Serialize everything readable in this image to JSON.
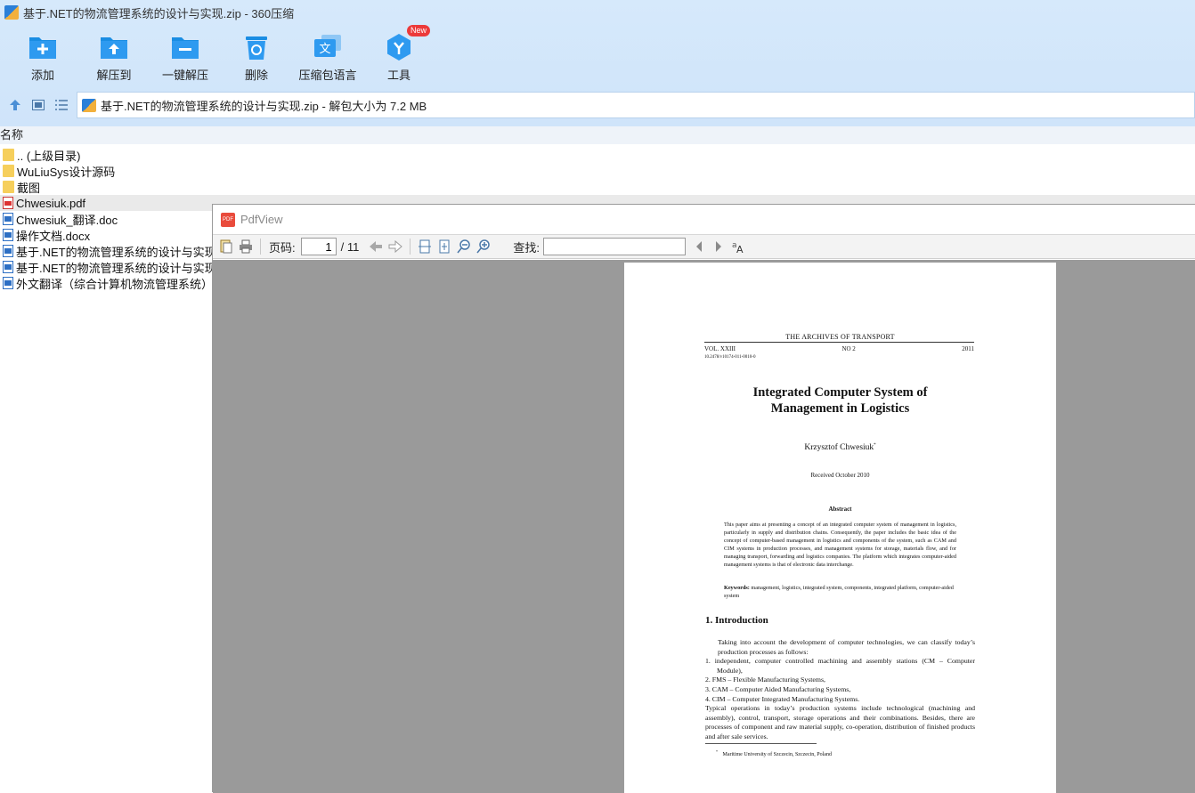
{
  "window": {
    "title": "基于.NET的物流管理系统的设计与实现.zip - 360压缩"
  },
  "toolbar": {
    "items": [
      {
        "label": "添加",
        "icon": "add-icon"
      },
      {
        "label": "解压到",
        "icon": "extract-to-icon"
      },
      {
        "label": "一键解压",
        "icon": "one-click-extract-icon"
      },
      {
        "label": "删除",
        "icon": "delete-icon"
      },
      {
        "label": "压缩包语言",
        "icon": "archive-language-icon"
      },
      {
        "label": "工具",
        "icon": "tools-icon",
        "badge": "New"
      }
    ]
  },
  "address": {
    "text": "基于.NET的物流管理系统的设计与实现.zip - 解包大小为 7.2 MB"
  },
  "list": {
    "column_name": "名称",
    "files": [
      {
        "name": ".. (上级目录)",
        "type": "folder"
      },
      {
        "name": "WuLiuSys设计源码",
        "type": "folder"
      },
      {
        "name": "截图",
        "type": "folder"
      },
      {
        "name": "Chwesiuk.pdf",
        "type": "pdf"
      },
      {
        "name": "Chwesiuk_翻译.doc",
        "type": "doc"
      },
      {
        "name": "操作文档.docx",
        "type": "doc"
      },
      {
        "name": "基于.NET的物流管理系统的设计与实现 毕",
        "type": "doc"
      },
      {
        "name": "基于.NET的物流管理系统的设计与实现 开",
        "type": "doc"
      },
      {
        "name": "外文翻译（综合计算机物流管理系统）.doc",
        "type": "doc"
      }
    ]
  },
  "pdfview": {
    "title": "PdfView",
    "page_label": "页码:",
    "page_current": "1",
    "page_total": "/ 11",
    "search_label": "查找:",
    "search_value": ""
  },
  "pdf_page": {
    "journal": "THE ARCHIVES OF TRANSPORT",
    "vol": "VOL. XXIII",
    "no": "NO 2",
    "year": "2011",
    "doi": "10.2478/v10174-011-0010-0",
    "title_line1": "Integrated Computer System of",
    "title_line2": "Management in Logistics",
    "author": "Krzysztof Chwesiuk",
    "author_mark": "*",
    "received": "Received October 2010",
    "abstract_heading": "Abstract",
    "abstract": "This paper aims at presenting a concept of an integrated computer system of management in logistics, particularly in supply and distribution chains. Consequently, the paper includes the basic idea of the concept of computer-based management in logistics and components of the system, such as CAM and CIM systems in production processes, and management systems for storage, materials flow, and for managing transport, forwarding and logistics companies. The platform which integrates computer-aided management systems is that of electronic data interchange.",
    "keywords_label": "Keywords:",
    "keywords": "management, logistics, integrated system, components, integrated platform, computer-aided system",
    "intro_heading": "1.  Introduction",
    "intro_p1": "Taking into account the development of computer technologies, we can classify today’s production processes as follows:",
    "intro_items": [
      "1.  independent, computer controlled machining and assembly stations (CM – Computer Module),",
      "2.  FMS – Flexible Manufacturing Systems,",
      "3.  CAM – Computer Aided Manufacturing Systems,",
      "4.  CIM – Computer Integrated Manufacturing Systems."
    ],
    "intro_p2": "Typical operations in today’s production systems include technological (machining and assembly), control, transport, storage operations and their combinations. Besides, there are processes of component and raw material supply, co-operation, distribution of finished products and after sale services.",
    "footnote_mark": "*",
    "footnote": "Maritime University of Szczecin, Szczecin, Poland"
  }
}
